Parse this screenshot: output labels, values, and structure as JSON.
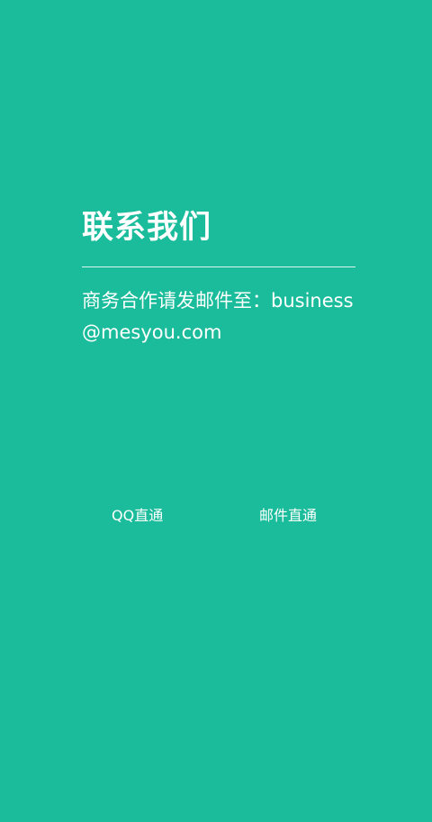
{
  "contact": {
    "title": "联系我们",
    "business_text": "商务合作请发邮件至：business@mesyou.com"
  },
  "links": {
    "qq_label": "QQ直通",
    "mail_label": "邮件直通"
  },
  "colors": {
    "background": "#1bbc9b",
    "text": "#ffffff"
  }
}
